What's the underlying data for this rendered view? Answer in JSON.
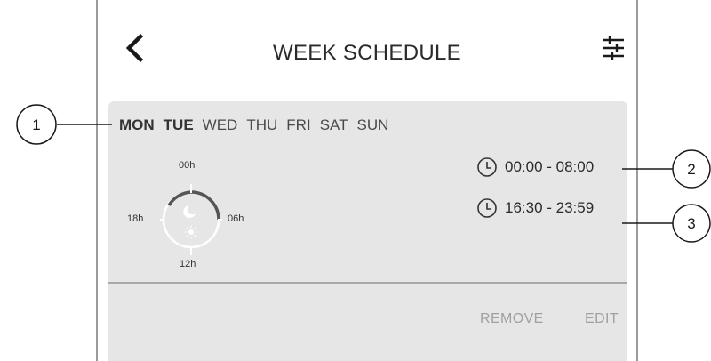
{
  "header": {
    "title": "WEEK SCHEDULE",
    "back_icon": "chevron-left-icon",
    "settings_icon": "sliders-icon"
  },
  "days": [
    {
      "label": "MON",
      "active": true
    },
    {
      "label": "TUE",
      "active": true
    },
    {
      "label": "WED",
      "active": false
    },
    {
      "label": "THU",
      "active": false
    },
    {
      "label": "FRI",
      "active": false
    },
    {
      "label": "SAT",
      "active": false
    },
    {
      "label": "SUN",
      "active": false
    }
  ],
  "dial": {
    "top_label": "00h",
    "right_label": "06h",
    "bottom_label": "12h",
    "left_label": "18h"
  },
  "slots": [
    {
      "time": "00:00 - 08:00",
      "icon": "clock-icon"
    },
    {
      "time": "16:30 - 23:59",
      "icon": "clock-icon"
    }
  ],
  "actions": {
    "remove_label": "REMOVE",
    "edit_label": "EDIT"
  },
  "callouts": [
    "1",
    "2",
    "3"
  ],
  "colors": {
    "card_background": "#e6e6e6",
    "disabled_text": "#a0a0a0",
    "frame_border": "#9a9a9a"
  }
}
